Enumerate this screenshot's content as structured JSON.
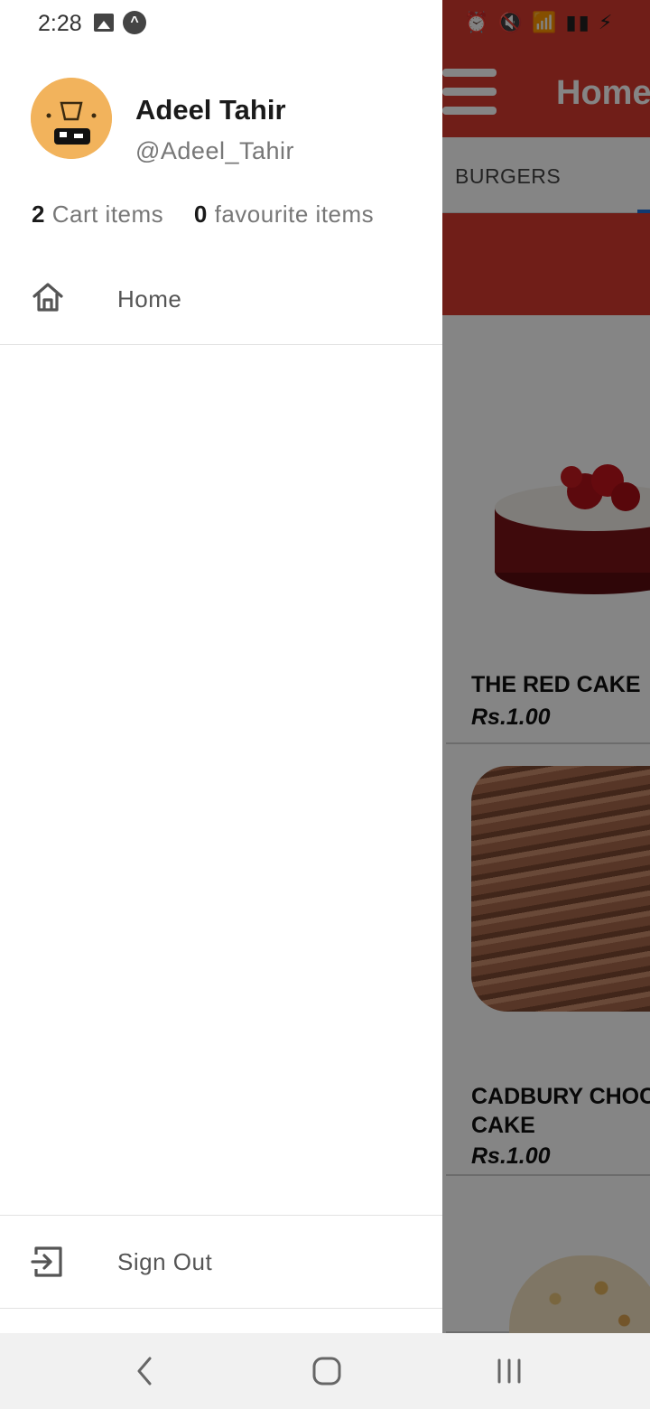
{
  "status_bar": {
    "time": "2:28",
    "left_icons": [
      "image-icon",
      "app-notification-icon"
    ],
    "right_icons": [
      "alarm-icon",
      "mute-icon",
      "wifi-icon",
      "signal-icon",
      "signal-icon",
      "battery-charging-icon"
    ]
  },
  "drawer": {
    "user": {
      "name": "Adeel Tahir",
      "handle": "@Adeel_Tahir"
    },
    "stats": {
      "cart_count": "2",
      "cart_label": "Cart items",
      "favourite_count": "0",
      "favourite_label": "favourite items"
    },
    "nav": {
      "home_label": "Home",
      "signout_label": "Sign Out"
    }
  },
  "app": {
    "title": "Home",
    "tabs": [
      {
        "label": "BURGERS"
      }
    ],
    "products": [
      {
        "title": "THE RED CAKE",
        "price": "Rs.1.00"
      },
      {
        "title": "CADBURY CHOC\nCAKE",
        "title_line1": "CADBURY CHOC",
        "title_line2": "CAKE",
        "price": "Rs.1.00"
      }
    ]
  },
  "colors": {
    "brand_red": "#d63a2f",
    "tab_indicator": "#1e6fd9"
  }
}
